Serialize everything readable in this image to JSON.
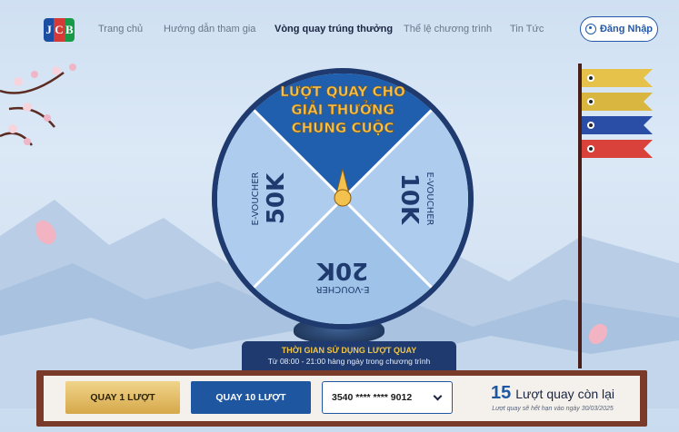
{
  "nav": {
    "logo_letters": [
      "J",
      "C",
      "B"
    ],
    "logo_colors": [
      "#1b4ea3",
      "#d63a36",
      "#189a48"
    ],
    "items": [
      {
        "label": "Trang chủ"
      },
      {
        "label": "Hướng dẫn tham gia"
      },
      {
        "label": "Vòng quay trúng thưởng",
        "active": true
      },
      {
        "label": "Thể lệ chương trình"
      },
      {
        "label": "Tin Tức"
      }
    ],
    "login_label": "Đăng Nhập",
    "login_icon": "user-circle-icon"
  },
  "wheel": {
    "top_lines": [
      "LƯỢT QUAY CHO",
      "GIẢI THƯỞNG",
      "CHUNG CUỘC"
    ],
    "left": {
      "prefix": "E-VOUCHER",
      "value": "50K"
    },
    "right": {
      "prefix": "E-VOUCHER",
      "value": "10K"
    },
    "bottom": {
      "prefix": "E-VOUCHER",
      "value": "20K"
    },
    "colors": {
      "top": "#1f5fae",
      "side": "#aacaec",
      "bottom": "#aacaec",
      "rim": "#1e3a6e",
      "gold": "#f2c14e"
    }
  },
  "time": {
    "title": "THỜI GIAN SỬ DỤNG LƯỢT QUAY",
    "subtitle": "Từ 08:00 - 21:00 hàng ngày trong chương trình"
  },
  "controls": {
    "spin_one": "QUAY 1 LƯỢT",
    "spin_ten": "QUAY 10 LƯỢT",
    "card_value": "3540 **** **** 9012",
    "spins_count": "15",
    "spins_label": "Lượt quay còn lại",
    "spins_note": "Lượt quay sẽ hết hạn vào ngày 30/03/2025"
  }
}
